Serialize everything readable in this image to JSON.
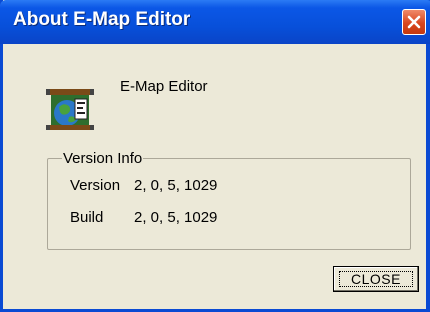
{
  "window": {
    "title": "About E-Map Editor",
    "close_icon": "close-icon"
  },
  "app": {
    "icon": "e-map-globe-icon",
    "name": "E-Map Editor"
  },
  "version_info": {
    "group_label": "Version Info",
    "rows": [
      {
        "label": "Version",
        "value": "2, 0, 5, 1029"
      },
      {
        "label": "Build",
        "value": "2, 0, 5, 1029"
      }
    ]
  },
  "buttons": {
    "close_label": "CLOSE"
  },
  "colors": {
    "titlebar": "#0850da",
    "window_bg": "#ece9d8",
    "close_button": "#d9461e"
  }
}
